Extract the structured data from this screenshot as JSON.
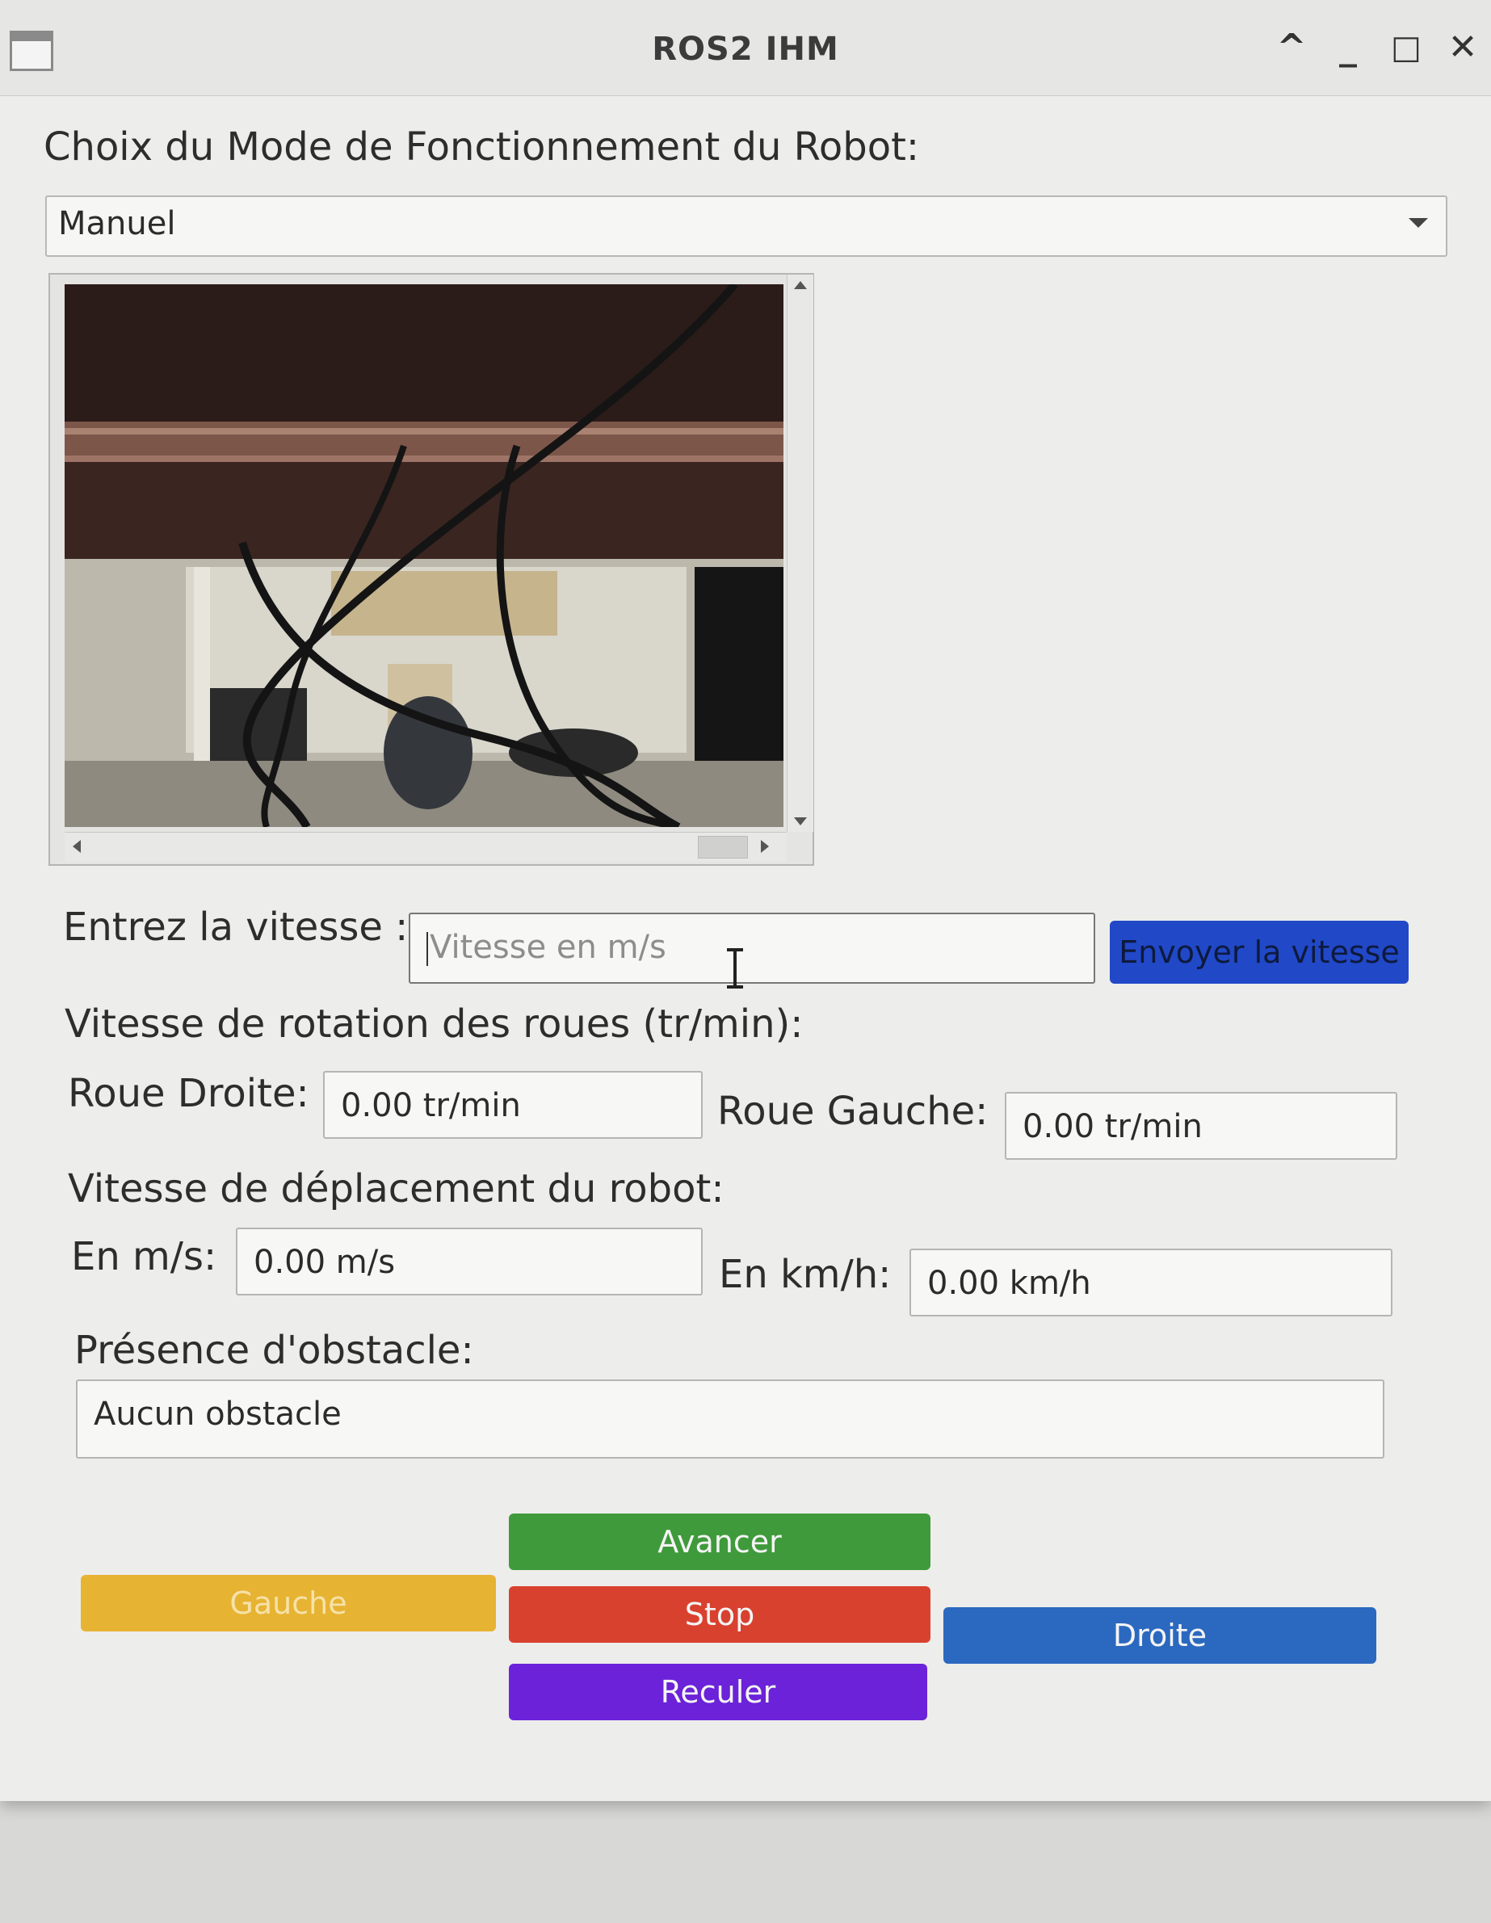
{
  "window": {
    "title": "ROS2 IHM",
    "controls": {
      "collapse": "^",
      "minimize": "_",
      "maximize": "□",
      "close": "✕"
    }
  },
  "mode": {
    "label": "Choix du Mode de Fonctionnement du Robot:",
    "selected": "Manuel"
  },
  "speed_input": {
    "label": "Entrez la vitesse :",
    "placeholder": "Vitesse en m/s",
    "value": "",
    "send_button": "Envoyer la vitesse"
  },
  "wheels": {
    "section_label": "Vitesse de rotation des roues (tr/min):",
    "right_label": "Roue Droite:",
    "right_value": "0.00 tr/min",
    "left_label": "Roue Gauche:",
    "left_value": "0.00 tr/min"
  },
  "robot_speed": {
    "section_label": "Vitesse de déplacement du robot:",
    "ms_label": "En m/s:",
    "ms_value": "0.00 m/s",
    "kmh_label": "En km/h:",
    "kmh_value": "0.00 km/h"
  },
  "obstacle": {
    "label": "Présence d'obstacle:",
    "value": "Aucun obstacle"
  },
  "controls": {
    "forward": "Avancer",
    "left": "Gauche",
    "stop": "Stop",
    "right": "Droite",
    "backward": "Reculer"
  },
  "colors": {
    "forward": "#3f9a3b",
    "left": "#e7b333",
    "stop": "#d9412f",
    "right": "#2b69c0",
    "backward": "#6b22d8",
    "send": "#2148c7"
  }
}
